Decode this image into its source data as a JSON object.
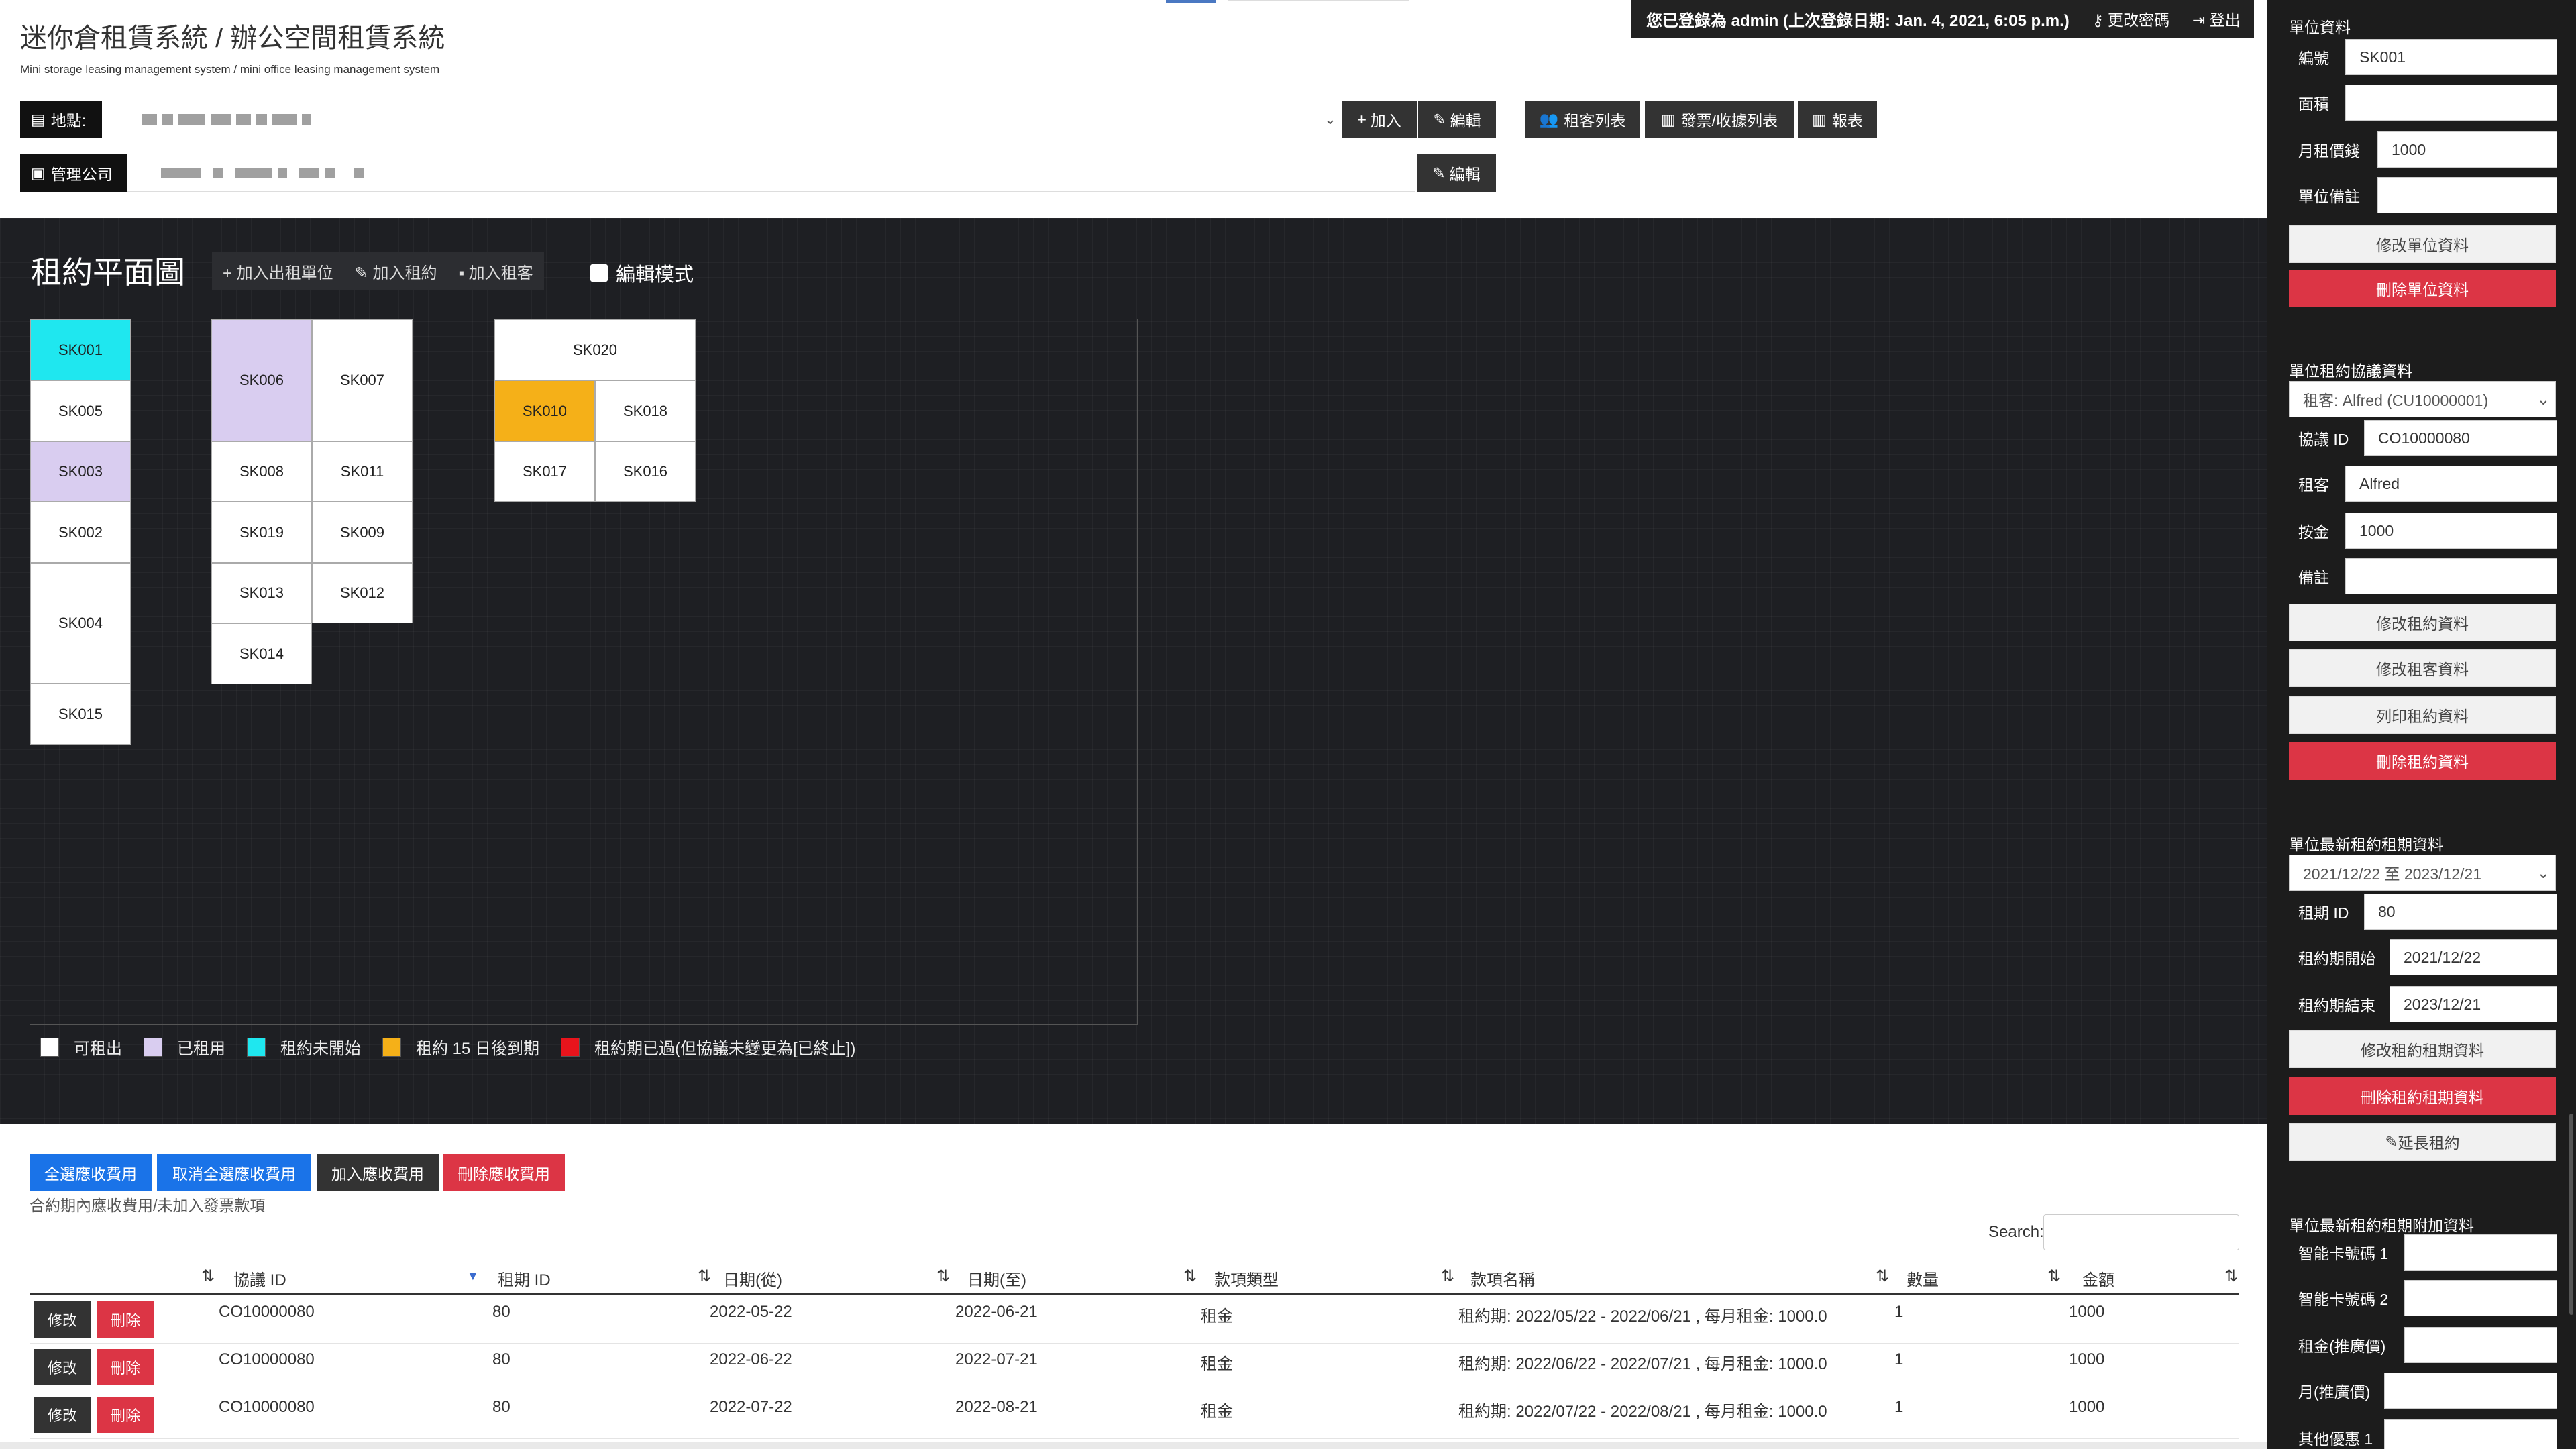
{
  "header": {
    "title": "迷你倉租賃系統 / 辦公空間租賃系統",
    "subtitle": "Mini storage leasing management system / mini office leasing management system",
    "login_status": "您已登錄為 admin (上次登錄日期: Jan. 4, 2021, 6:05 p.m.)",
    "change_password": "更改密碼",
    "logout": "登出"
  },
  "location": {
    "label": "地點:",
    "add": "加入",
    "edit": "編輯"
  },
  "company": {
    "label": "管理公司",
    "edit": "編輯"
  },
  "nav": {
    "tenants": "租客列表",
    "invoices": "發票/收據列表",
    "reports": "報表"
  },
  "plan": {
    "title": "租約平面圖",
    "add_unit": "加入出租單位",
    "add_lease": "加入租約",
    "add_tenant": "加入租客",
    "edit_mode": "編輯模式",
    "units": [
      {
        "id": "SK001",
        "status": "not-started"
      },
      {
        "id": "SK005",
        "status": "available"
      },
      {
        "id": "SK003",
        "status": "rented"
      },
      {
        "id": "SK002",
        "status": "available"
      },
      {
        "id": "SK004",
        "status": "available"
      },
      {
        "id": "SK015",
        "status": "available"
      },
      {
        "id": "SK006",
        "status": "rented"
      },
      {
        "id": "SK007",
        "status": "available"
      },
      {
        "id": "SK008",
        "status": "available"
      },
      {
        "id": "SK011",
        "status": "available"
      },
      {
        "id": "SK019",
        "status": "available"
      },
      {
        "id": "SK009",
        "status": "available"
      },
      {
        "id": "SK013",
        "status": "available"
      },
      {
        "id": "SK012",
        "status": "available"
      },
      {
        "id": "SK014",
        "status": "available"
      },
      {
        "id": "SK020",
        "status": "available"
      },
      {
        "id": "SK010",
        "status": "expiring"
      },
      {
        "id": "SK018",
        "status": "available"
      },
      {
        "id": "SK017",
        "status": "available"
      },
      {
        "id": "SK016",
        "status": "available"
      }
    ],
    "legend": [
      {
        "label": "可租出",
        "color": "#ffffff"
      },
      {
        "label": "已租用",
        "color": "#d9cdf0"
      },
      {
        "label": "租約未開始",
        "color": "#1fe7ef"
      },
      {
        "label": "租約 15 日後到期",
        "color": "#f5b018"
      },
      {
        "label": "租約期已過(但協議未變更為[已終止])",
        "color": "#e8141c"
      }
    ],
    "status_colors": {
      "available": "#ffffff",
      "rented": "#d9cdf0",
      "not-started": "#1fe7ef",
      "expiring": "#f5b018"
    }
  },
  "charges": {
    "select_all": "全選應收費用",
    "deselect_all": "取消全選應收費用",
    "add": "加入應收費用",
    "delete": "刪除應收費用",
    "caption": "合約期內應收費用/未加入發票款項",
    "search_label": "Search:",
    "columns": [
      "協議 ID",
      "租期 ID",
      "日期(從)",
      "日期(至)",
      "款項類型",
      "款項名稱",
      "數量",
      "金額"
    ],
    "edit": "修改",
    "remove": "刪除",
    "rows": [
      [
        "CO10000080",
        "80",
        "2022-05-22",
        "2022-06-21",
        "租金",
        "租約期: 2022/05/22 - 2022/06/21 , 每月租金: 1000.0",
        "1",
        "1000"
      ],
      [
        "CO10000080",
        "80",
        "2022-06-22",
        "2022-07-21",
        "租金",
        "租約期: 2022/06/22 - 2022/07/21 , 每月租金: 1000.0",
        "1",
        "1000"
      ],
      [
        "CO10000080",
        "80",
        "2022-07-22",
        "2022-08-21",
        "租金",
        "租約期: 2022/07/22 - 2022/08/21 , 每月租金: 1000.0",
        "1",
        "1000"
      ]
    ]
  },
  "panel": {
    "unit_section": "單位資料",
    "unit_fields": [
      {
        "label": "編號",
        "value": "SK001"
      },
      {
        "label": "面積",
        "value": ""
      },
      {
        "label": "月租價錢",
        "value": "1000"
      },
      {
        "label": "單位備註",
        "value": ""
      }
    ],
    "modify_unit": "修改單位資料",
    "delete_unit": "刪除單位資料",
    "lease_section": "單位租約協議資料",
    "lease_select": "租客: Alfred (CU10000001)",
    "lease_fields": [
      {
        "label": "協議 ID",
        "value": "CO10000080"
      },
      {
        "label": "租客",
        "value": "Alfred"
      },
      {
        "label": "按金",
        "value": "1000"
      },
      {
        "label": "備註",
        "value": ""
      }
    ],
    "modify_lease": "修改租約資料",
    "modify_tenant": "修改租客資料",
    "print_lease": "列印租約資料",
    "delete_lease": "刪除租約資料",
    "period_section": "單位最新租約租期資料",
    "period_select": "2021/12/22 至 2023/12/21",
    "period_fields": [
      {
        "label": "租期 ID",
        "value": "80"
      },
      {
        "label": "租約期開始",
        "value": "2021/12/22"
      },
      {
        "label": "租約期結束",
        "value": "2023/12/21"
      }
    ],
    "modify_period": "修改租約租期資料",
    "delete_period": "刪除租約租期資料",
    "extend": "延長租約",
    "extra_section": "單位最新租約租期附加資料",
    "extra_fields": [
      {
        "label": "智能卡號碼 1",
        "value": ""
      },
      {
        "label": "智能卡號碼 2",
        "value": ""
      },
      {
        "label": "租金(推廣價)",
        "value": ""
      },
      {
        "label": "月(推廣價)",
        "value": ""
      },
      {
        "label": "其他優惠 1",
        "value": ""
      }
    ]
  }
}
